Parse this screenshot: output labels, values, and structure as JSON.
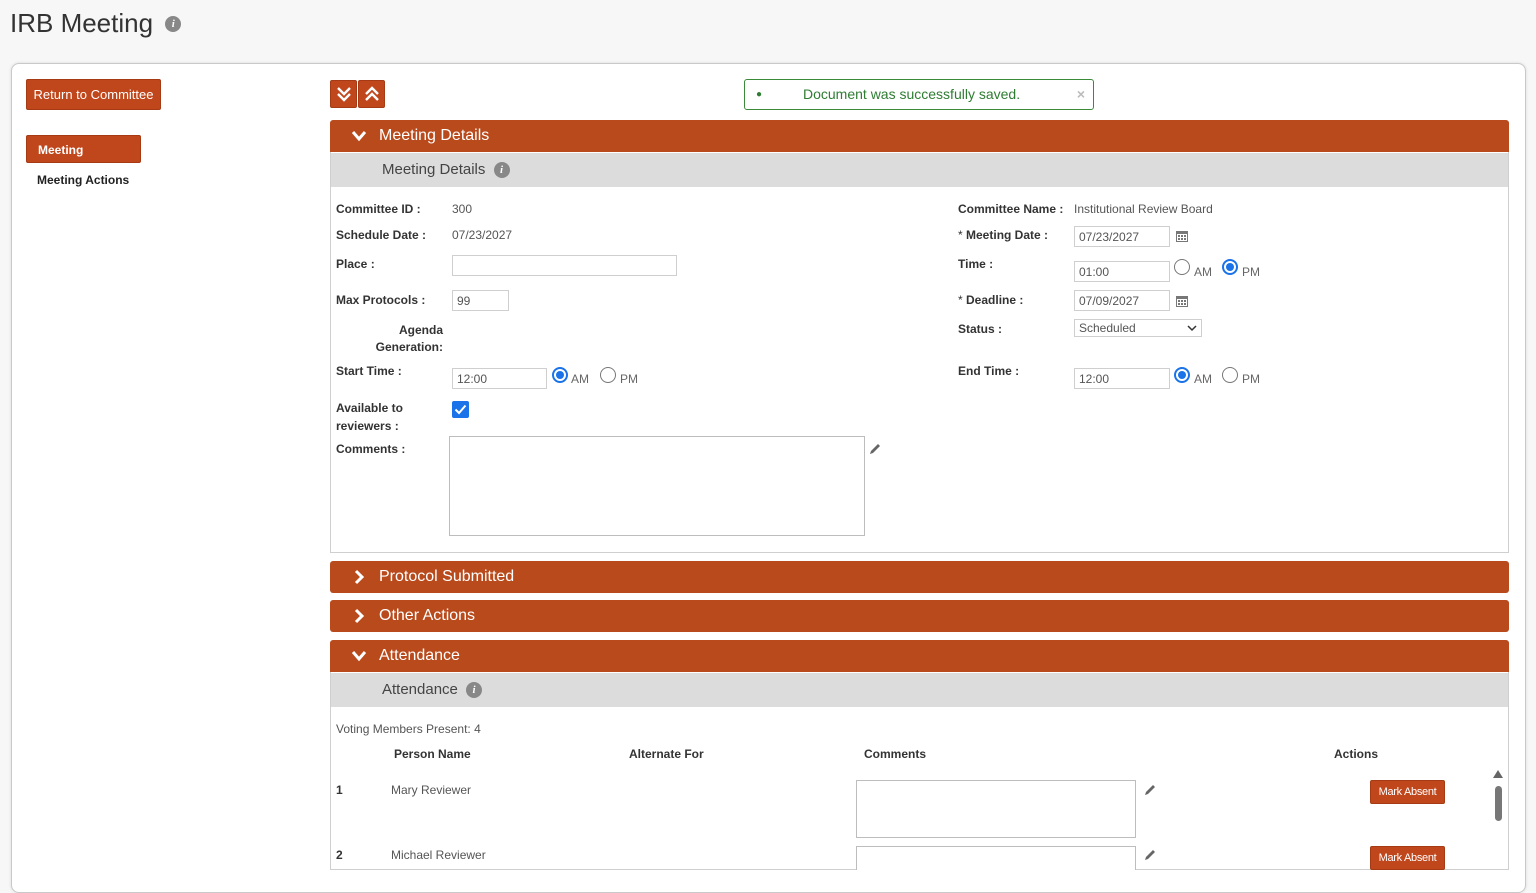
{
  "page": {
    "title": "IRB Meeting"
  },
  "sidebar": {
    "return_label": "Return to Committee",
    "items": [
      {
        "label": "Meeting"
      },
      {
        "label": "Meeting Actions"
      }
    ]
  },
  "alert": {
    "message": "Document was successfully saved.",
    "close": "×"
  },
  "sections": {
    "meeting_details": {
      "title": "Meeting Details",
      "subtitle": "Meeting Details"
    },
    "protocol_submitted": {
      "title": "Protocol Submitted"
    },
    "other_actions": {
      "title": "Other Actions"
    },
    "attendance": {
      "title": "Attendance",
      "subtitle": "Attendance"
    }
  },
  "form": {
    "committee_id": {
      "label": "Committee ID :",
      "value": "300"
    },
    "schedule_date": {
      "label": "Schedule Date :",
      "value": "07/23/2027"
    },
    "place": {
      "label": "Place :",
      "value": ""
    },
    "max_protocols": {
      "label": "Max Protocols :",
      "value": "99"
    },
    "agenda_generation": {
      "label_line1": "Agenda",
      "label_line2": "Generation:"
    },
    "start_time": {
      "label": "Start Time :",
      "value": "12:00",
      "am": "AM",
      "pm": "PM",
      "selected": "AM"
    },
    "available": {
      "label_line1": "Available to",
      "label_line2": "reviewers :",
      "checked": true
    },
    "comments": {
      "label": "Comments :",
      "value": ""
    },
    "committee_name": {
      "label": "Committee Name :",
      "value": "Institutional Review Board"
    },
    "meeting_date": {
      "req": "*",
      "label": "Meeting Date :",
      "value": "07/23/2027"
    },
    "time": {
      "label": "Time :",
      "value": "01:00",
      "am": "AM",
      "pm": "PM",
      "selected": "PM"
    },
    "deadline": {
      "req": "*",
      "label": "Deadline :",
      "value": "07/09/2027"
    },
    "status": {
      "label": "Status :",
      "value": "Scheduled"
    },
    "end_time": {
      "label": "End Time :",
      "value": "12:00",
      "am": "AM",
      "pm": "PM",
      "selected": "AM"
    }
  },
  "attendance": {
    "voting_present": "Voting Members Present: 4",
    "columns": {
      "person": "Person Name",
      "alternate": "Alternate For",
      "comments": "Comments",
      "actions": "Actions"
    },
    "rows": [
      {
        "num": "1",
        "name": "Mary Reviewer",
        "action": "Mark Absent"
      },
      {
        "num": "2",
        "name": "Michael Reviewer",
        "action": "Mark Absent"
      }
    ]
  },
  "colors": {
    "accent": "#c0461b",
    "header": "#b84a1c",
    "success": "#2e7d32",
    "radio": "#1a73e8"
  }
}
